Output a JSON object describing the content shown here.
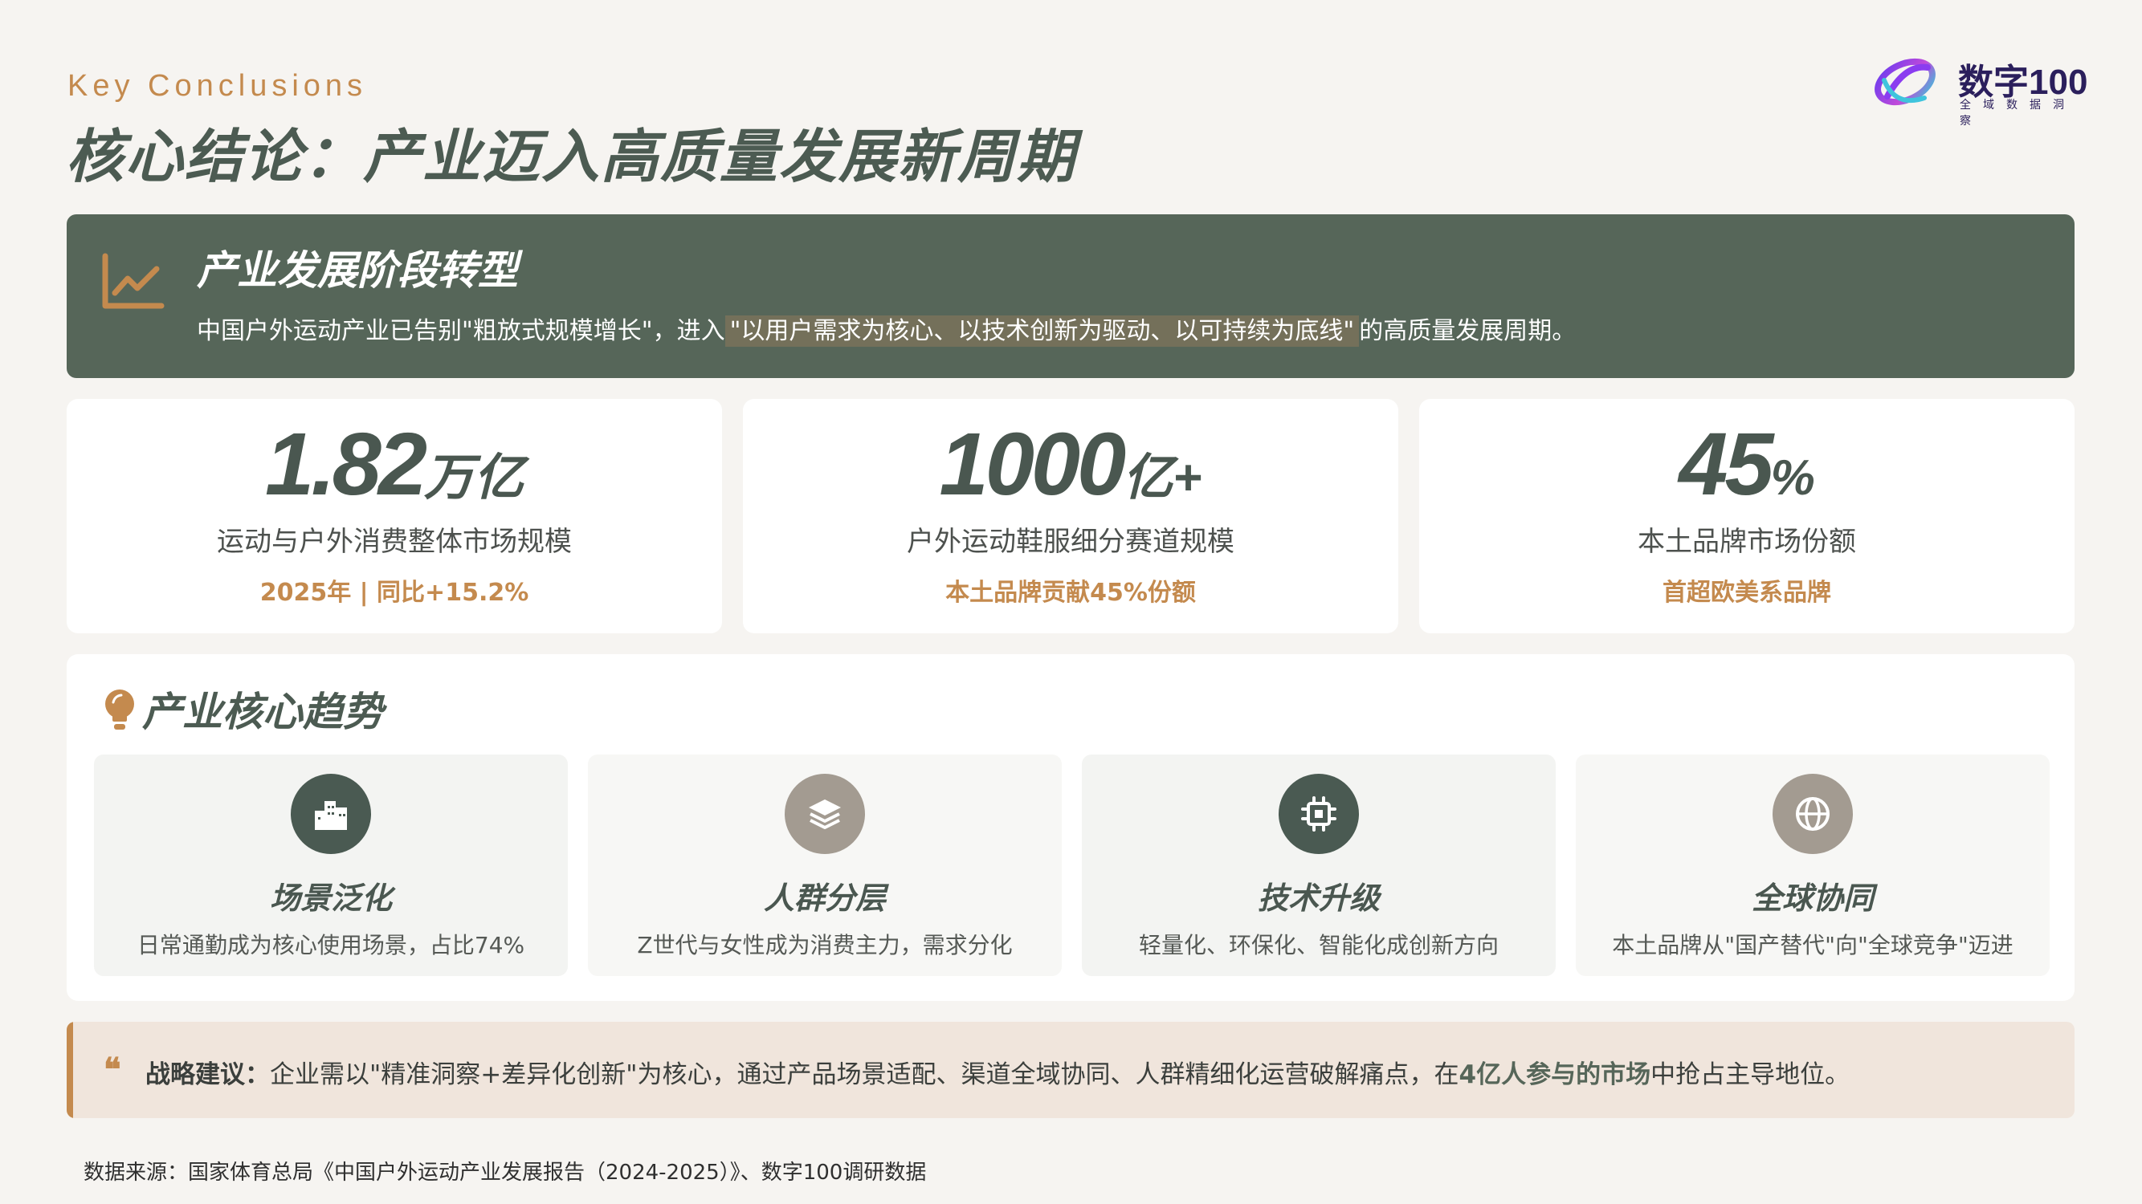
{
  "header": {
    "eyebrow": "Key Conclusions",
    "title": "核心结论：产业迈入高质量发展新周期",
    "logo_text": "数字100",
    "logo_sub": "全域数据洞察"
  },
  "banner": {
    "icon": "trend-line-chart-icon",
    "title": "产业发展阶段转型",
    "text_before": "中国户外运动产业已告别\"粗放式规模增长\"，进入",
    "text_highlight": "\"以用户需求为核心、以技术创新为驱动、以可持续为底线\"",
    "text_after": "的高质量发展周期。"
  },
  "stats": [
    {
      "value": "1.82",
      "unit": "万亿",
      "label": "运动与户外消费整体市场规模",
      "note": "2025年 | 同比+15.2%"
    },
    {
      "value": "1000",
      "unit": "亿+",
      "label": "户外运动鞋服细分赛道规模",
      "note": "本土品牌贡献45%份额"
    },
    {
      "value": "45",
      "unit": "%",
      "label": "本土品牌市场份额",
      "note": "首超欧美系品牌"
    }
  ],
  "trends": {
    "heading": "产业核心趋势",
    "heading_icon": "lightbulb-icon",
    "items": [
      {
        "icon": "city-buildings-icon",
        "icon_color": "#4a5a52",
        "title": "场景泛化",
        "desc": "日常通勤成为核心使用场景，占比74%"
      },
      {
        "icon": "layers-icon",
        "icon_color": "#a39b91",
        "title": "人群分层",
        "desc": "Z世代与女性成为消费主力，需求分化"
      },
      {
        "icon": "chip-icon",
        "icon_color": "#4a5a52",
        "title": "技术升级",
        "desc": "轻量化、环保化、智能化成创新方向"
      },
      {
        "icon": "globe-icon",
        "icon_color": "#a39b91",
        "title": "全球协同",
        "desc": "本土品牌从\"国产替代\"向\"全球竞争\"迈进"
      }
    ]
  },
  "recommendation": {
    "quote_icon": "quote-icon",
    "label": "战略建议：",
    "text_before": "企业需以\"精准洞察+差异化创新\"为核心，通过产品场景适配、渠道全域协同、人群精细化运营破解痛点，在",
    "text_highlight": "4亿人参与的市场",
    "text_after": "中抢占主导地位。"
  },
  "source": "数据来源：国家体育总局《中国户外运动产业发展报告（2024-2025）》、数字100调研数据",
  "colors": {
    "accent": "#c48a4e",
    "banner": "#566659",
    "title": "#4c5b52",
    "background": "#f6f4f1"
  }
}
